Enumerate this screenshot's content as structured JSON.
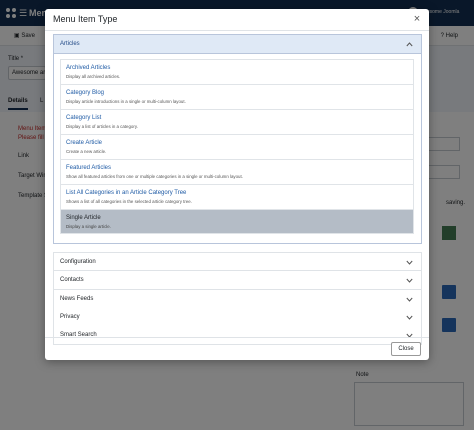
{
  "background": {
    "topbar": {
      "title": "Menu",
      "user_text": "Awesome Joomla"
    },
    "toolbar": {
      "save_label": "Save",
      "help_label": "Help"
    },
    "form": {
      "title_label": "Title *",
      "title_value": "Awesome ar",
      "tab_details": "Details",
      "tab_other": "L",
      "required_line1": "Menu Item",
      "required_line2": "Please fill i",
      "link_label": "Link",
      "target_label": "Target Win",
      "template_label": "Template S",
      "saving_text": "saving.",
      "note_label": "Note"
    }
  },
  "modal": {
    "title": "Menu Item Type",
    "close_icon": "×",
    "open_section": {
      "label": "Articles",
      "items": [
        {
          "title": "Archived Articles",
          "description": "Display all archived articles."
        },
        {
          "title": "Category Blog",
          "description": "Display article introductions in a single or multi-column layout."
        },
        {
          "title": "Category List",
          "description": "Display a list of articles in a category."
        },
        {
          "title": "Create Article",
          "description": "Create a new article."
        },
        {
          "title": "Featured Articles",
          "description": "Show all featured articles from one or multiple categories in a single or multi-column layout."
        },
        {
          "title": "List All Categories in an Article Category Tree",
          "description": "Shows a list of all categories in the selected article category tree."
        },
        {
          "title": "Single Article",
          "description": "Display a single article."
        }
      ],
      "selected_index": 6
    },
    "collapsed_sections": [
      {
        "label": "Configuration"
      },
      {
        "label": "Contacts"
      },
      {
        "label": "News Feeds"
      },
      {
        "label": "Privacy"
      },
      {
        "label": "Smart Search"
      }
    ],
    "close_button_label": "Close"
  },
  "colors": {
    "topbar": "#132f53",
    "accent_link": "#1f5ba5",
    "open_header_bg": "#dfe9f6",
    "selected_item_bg": "#b4bcc6",
    "required_text": "#c52827"
  },
  "icons": {
    "logo": "joomla-logo-icon",
    "save": "save-icon",
    "help": "question-icon",
    "chevron_up": "chevron-up-icon",
    "chevron_down": "chevron-down-icon",
    "close": "close-icon"
  }
}
